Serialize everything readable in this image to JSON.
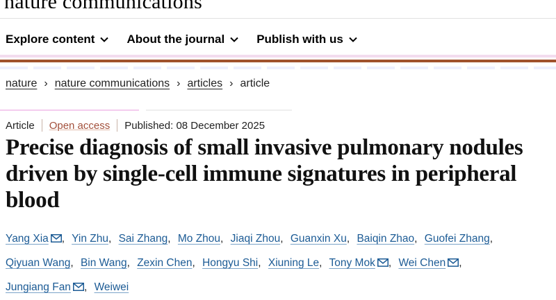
{
  "masthead": {
    "title": "nature communications"
  },
  "nav": {
    "items": [
      {
        "label": "Explore content",
        "icon": "chevron-down-icon"
      },
      {
        "label": "About the journal",
        "icon": "chevron-down-icon"
      },
      {
        "label": "Publish with us",
        "icon": "chevron-down-icon"
      }
    ]
  },
  "breadcrumb": {
    "items": [
      "nature",
      "nature communications",
      "articles"
    ],
    "current": "article",
    "separator": "›"
  },
  "meta": {
    "type": "Article",
    "access": "Open access",
    "published": "Published: 08 December 2025"
  },
  "article": {
    "title": "Precise diagnosis of small invasive pulmonary nodules driven by single-cell immune signatures in peripheral blood"
  },
  "authors": [
    {
      "name": "Yang Xia",
      "email": true
    },
    {
      "name": "Yin Zhu",
      "email": false
    },
    {
      "name": "Sai Zhang",
      "email": false
    },
    {
      "name": "Mo Zhou",
      "email": false
    },
    {
      "name": "Jiaqi Zhou",
      "email": false
    },
    {
      "name": "Guanxin Xu",
      "email": false
    },
    {
      "name": "Baiqin Zhao",
      "email": false
    },
    {
      "name": "Guofei Zhang",
      "email": false
    },
    {
      "name": "Qiyuan Wang",
      "email": false
    },
    {
      "name": "Bin Wang",
      "email": false
    },
    {
      "name": "Zexin Chen",
      "email": false
    },
    {
      "name": "Hongyu Shi",
      "email": false
    },
    {
      "name": "Xiuning Le",
      "email": false
    },
    {
      "name": "Tony Mok",
      "email": true
    },
    {
      "name": "Wei Chen",
      "email": true
    },
    {
      "name": "Jungiang Fan",
      "email": true
    },
    {
      "name": "Weiwei",
      "email": false
    }
  ],
  "colors": {
    "accent": "#a0522d",
    "link": "#1c5b95",
    "open_access": "#a24f3a"
  }
}
